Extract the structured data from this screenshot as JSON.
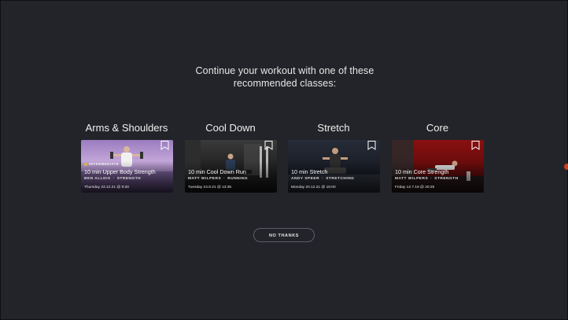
{
  "heading": {
    "line1": "Continue your workout with one of these",
    "line2": "recommended classes:"
  },
  "cards": [
    {
      "category": "Arms & Shoulders",
      "level": "INTERMEDIATE",
      "title": "10 min Upper Body Strength",
      "instructor": "BEN ALLDIS",
      "type": "STRENGTH",
      "date": "Thursday 23.12.21 @ 9:30",
      "bg": "linear-gradient(180deg, #9a7cc0 0%, #c3a6d8 40%, #8a6fa8 70%, #4d3b68 100%)"
    },
    {
      "category": "Cool Down",
      "level": "",
      "title": "10 min Cool Down Run",
      "instructor": "MATT WILPERS",
      "type": "RUNNING",
      "date": "Tuesday 24.8.21 @ 13:35",
      "bg": "linear-gradient(180deg, #3a3a3a 0%, #242424 45%, #151515 100%)"
    },
    {
      "category": "Stretch",
      "level": "",
      "title": "10 min Stretch",
      "instructor": "ANDY SPEER",
      "type": "STRETCHING",
      "date": "Monday 20.12.21 @ 16:00",
      "bg": "linear-gradient(180deg, #262c38 0%, #1a1e27 50%, #12151b 100%)"
    },
    {
      "category": "Core",
      "level": "",
      "title": "10 min Core Strength",
      "instructor": "MATT WILPERS",
      "type": "STRENGTH",
      "date": "Friday 12.7.19 @ 20:25",
      "bg": "linear-gradient(180deg, #8a1010 0%, #6a0c0c 45%, #3a0808 100%)"
    }
  ],
  "no_thanks_label": "NO THANKS",
  "colors": {
    "background": "#222429",
    "level_dot": "#e0b43c",
    "button_border": "#5b5e66"
  }
}
